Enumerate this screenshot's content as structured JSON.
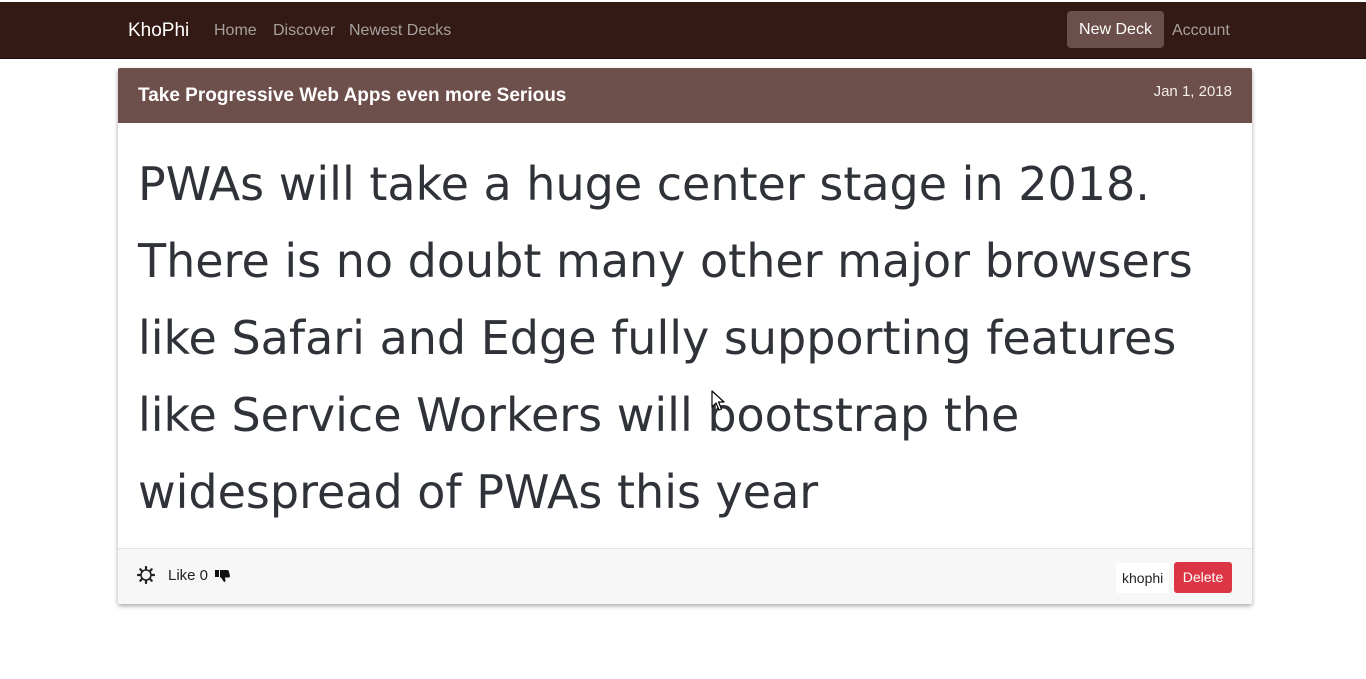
{
  "navbar": {
    "brand": "KhoPhi",
    "links": {
      "home": "Home",
      "discover": "Discover",
      "newest": "Newest Decks"
    },
    "new_deck_label": "New Deck",
    "account_label": "Account",
    "background_color": "#331a15"
  },
  "card": {
    "title": "Take Progressive Web Apps even more Serious",
    "date": "Jan 1, 2018",
    "body": "PWAs will take a huge center stage in 2018. There is no doubt many other major browsers like Safari and Edge fully supporting features like Service Workers will bootstrap the widespread of PWAs this year",
    "header_color": "#6d4f4b",
    "footer": {
      "settings_icon": "gear-icon",
      "like_text": "Like 0",
      "dislike_icon": "thumbs-down-icon",
      "username": "khophi",
      "delete_label": "Delete",
      "delete_color": "#dc3545"
    }
  }
}
